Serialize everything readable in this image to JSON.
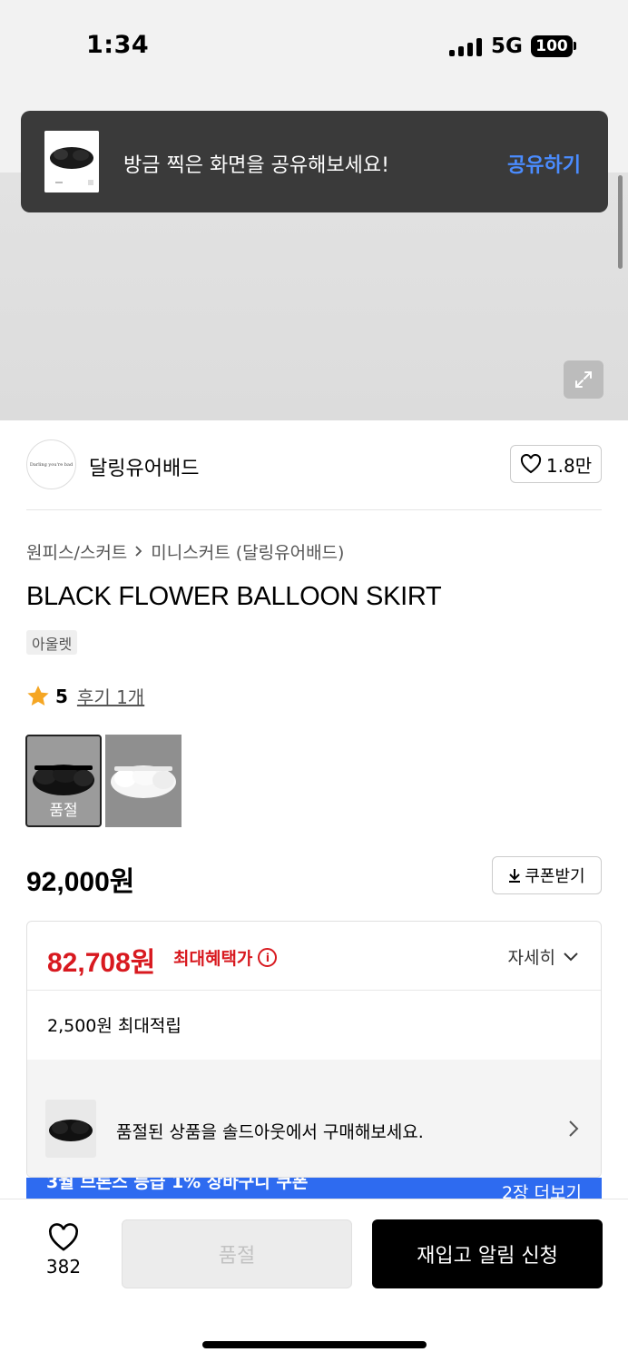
{
  "status_bar": {
    "time": "1:34",
    "network": "5G",
    "battery": "100"
  },
  "share_toast": {
    "message": "방금 찍은 화면을 공유해보세요!",
    "action": "공유하기"
  },
  "brand": {
    "logo_text": "Darling you're bad",
    "name": "달링유어배드",
    "likes": "1.8만"
  },
  "product": {
    "breadcrumb": [
      "원피스/스커트",
      "미니스커트 (달링유어배드)"
    ],
    "title": "BLACK FLOWER BALLOON SKIRT",
    "tag": "아울렛",
    "rating": "5",
    "reviews": "후기 1개",
    "thumbnails": [
      {
        "color": "black",
        "label": "품절"
      },
      {
        "color": "white",
        "label": ""
      }
    ],
    "price": "92,000원",
    "coupon_label": "쿠폰받기"
  },
  "benefit": {
    "sale_price": "82,708원",
    "sale_label": "최대혜택가",
    "detail_label": "자세히",
    "points": "2,500원 최대적립",
    "soldout_banner": "품절된 상품을 솔드아웃에서 구매해보세요."
  },
  "promo": {
    "text": "3월 브론즈 등급 1% 장바구니 쿠폰",
    "more": "2장 더보기"
  },
  "bottom_bar": {
    "wish_count": "382",
    "soldout_button": "품절",
    "restock_button": "재입고 알림 신청"
  },
  "colors": {
    "sale_red": "#d8191f",
    "toast_bg": "#3a3a3a",
    "toast_action": "#4a8cff",
    "promo_blue": "#2e6bf0"
  }
}
